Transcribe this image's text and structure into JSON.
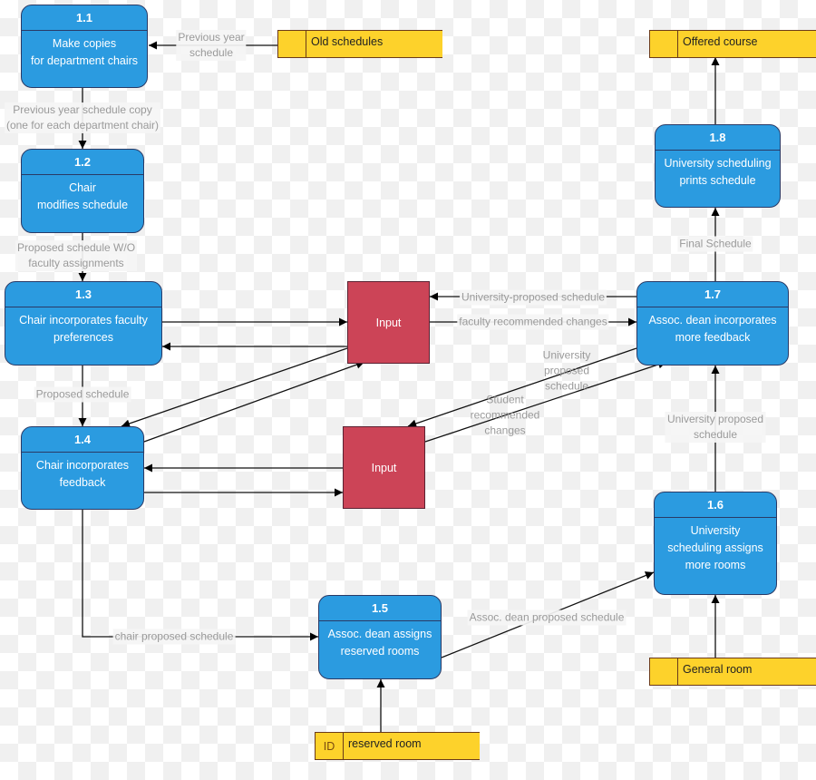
{
  "processes": [
    {
      "id": "1.1",
      "text": "Make copies\nfor department chairs"
    },
    {
      "id": "1.2",
      "text": "Chair\nmodifies schedule"
    },
    {
      "id": "1.3",
      "text": "Chair incorporates faculty\npreferences"
    },
    {
      "id": "1.4",
      "text": "Chair incorporates\nfeedback"
    },
    {
      "id": "1.5",
      "text": "Assoc. dean assigns\nreserved rooms"
    },
    {
      "id": "1.6",
      "text": "University\nscheduling assigns\nmore rooms"
    },
    {
      "id": "1.7",
      "text": "Assoc. dean incorporates\nmore feedback"
    },
    {
      "id": "1.8",
      "text": "University scheduling\nprints schedule"
    }
  ],
  "inputs": [
    "Input",
    "Input"
  ],
  "stores": [
    {
      "cell": "",
      "name": "Old schedules"
    },
    {
      "cell": "",
      "name": "Offered course"
    },
    {
      "cell": "",
      "name": "General room"
    },
    {
      "cell": "ID",
      "name": "reserved room"
    }
  ],
  "flows": {
    "old_to_11": "Previous year\nschedule",
    "p11_to_12": "Previous year schedule copy\n(one for each department chair)",
    "p12_to_13": "Proposed schedule W/O\nfaculty assignments",
    "p13_to_14": "Proposed schedule",
    "p17_to_input1": "University-proposed schedule",
    "input1_to_17": "faculty recommended changes",
    "p17_to_input2": "University\nproposed\nschedule",
    "input2_to_17": "Student\nrecommended\nchanges",
    "p16_to_17": "University proposed schedule",
    "p17_to_18": "Final Schedule",
    "p14_to_15": "chair proposed schedule",
    "p15_to_16": "Assoc. dean proposed schedule"
  },
  "colors": {
    "process": "#2b9be0",
    "input": "#cc4457",
    "store": "#fdd22b",
    "flow_label": "#9a9a9a"
  }
}
